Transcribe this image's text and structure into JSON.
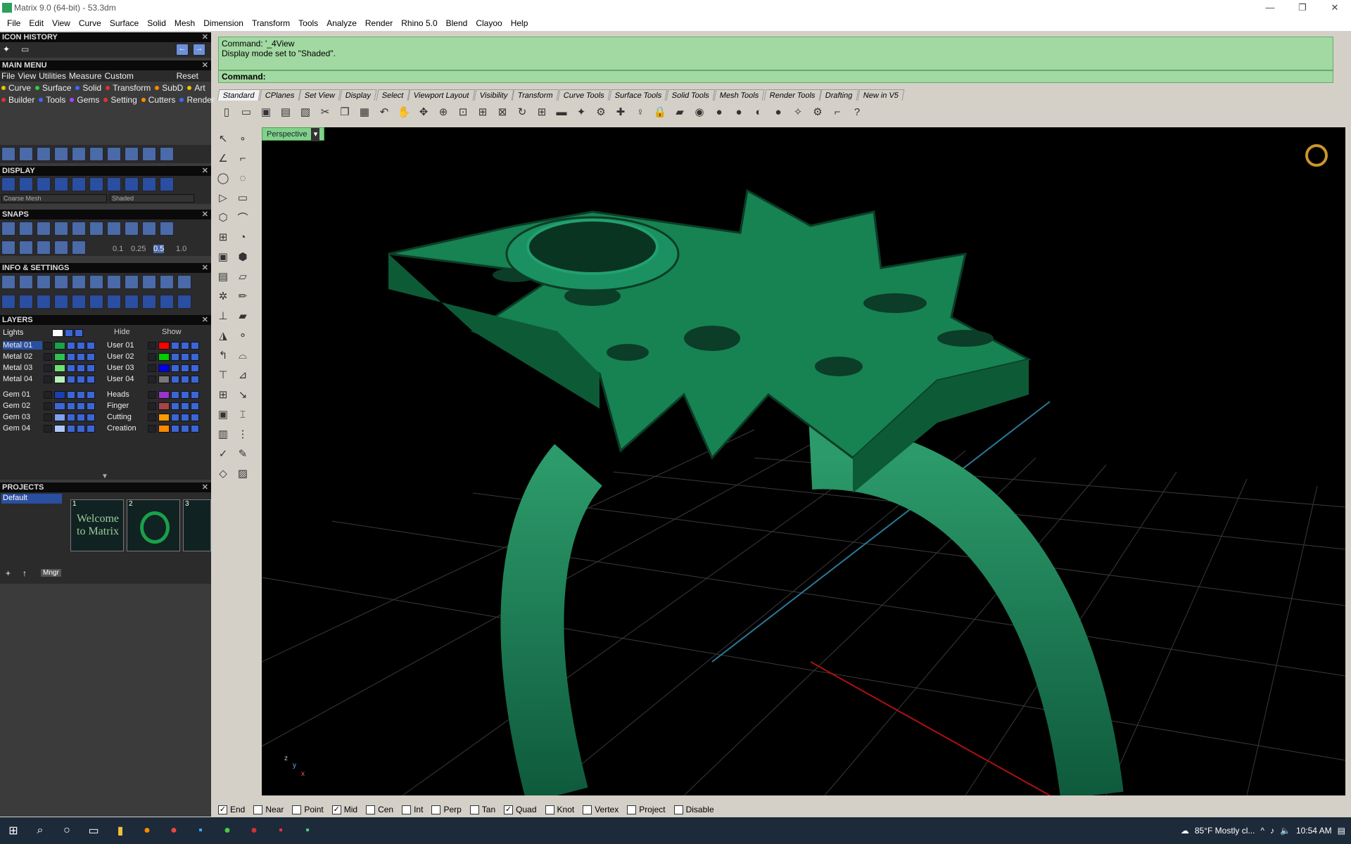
{
  "window": {
    "title": "Matrix 9.0 (64-bit) - 53.3dm",
    "controls": [
      "—",
      "❐",
      "✕"
    ]
  },
  "menubar": [
    "File",
    "Edit",
    "View",
    "Curve",
    "Surface",
    "Solid",
    "Mesh",
    "Dimension",
    "Transform",
    "Tools",
    "Analyze",
    "Render",
    "Rhino 5.0",
    "Blend",
    "Clayoo",
    "Help"
  ],
  "left": {
    "icon_history": "ICON HISTORY",
    "main_menu": "MAIN MENU",
    "mm_row1": [
      "File",
      "View",
      "Utilities",
      "Measure",
      "Custom"
    ],
    "mm_reset": "Reset",
    "mm_row2": [
      {
        "label": "Curve",
        "color": "#f0c000"
      },
      {
        "label": "Surface",
        "color": "#33cc44"
      },
      {
        "label": "Solid",
        "color": "#4466ff"
      },
      {
        "label": "Transform",
        "color": "#dd3333"
      },
      {
        "label": "SubD",
        "color": "#ff8800"
      },
      {
        "label": "Art",
        "color": "#f0c000"
      }
    ],
    "mm_row3": [
      {
        "label": "Builder",
        "color": "#dd3333"
      },
      {
        "label": "Tools",
        "color": "#4466ff"
      },
      {
        "label": "Gems",
        "color": "#aa44ff"
      },
      {
        "label": "Setting",
        "color": "#dd3333"
      },
      {
        "label": "Cutters",
        "color": "#ff8800"
      },
      {
        "label": "Render",
        "color": "#4466ff"
      }
    ],
    "display": "DISPLAY",
    "display_select1": "Coarse Mesh",
    "display_select2": "Shaded",
    "snaps": "SNAPS",
    "snap_values": [
      "0.1",
      "0.25",
      "0.5",
      "1.0"
    ],
    "info_settings": "INFO & SETTINGS",
    "layers": "LAYERS",
    "lights": "Lights",
    "hide": "Hide",
    "show": "Show",
    "layers_left": [
      {
        "name": "Metal 01",
        "color": "#1aa04a"
      },
      {
        "name": "Metal 02",
        "color": "#30c050"
      },
      {
        "name": "Metal 03",
        "color": "#70e070"
      },
      {
        "name": "Metal 04",
        "color": "#b8f0b8"
      },
      {
        "name": "Gem 01",
        "color": "#1a3fb0"
      },
      {
        "name": "Gem 02",
        "color": "#3f66d8"
      },
      {
        "name": "Gem 03",
        "color": "#7fa0ee"
      },
      {
        "name": "Gem 04",
        "color": "#b0c8f8"
      }
    ],
    "layers_right": [
      {
        "name": "User 01",
        "color": "#ff0000"
      },
      {
        "name": "User 02",
        "color": "#00cc00"
      },
      {
        "name": "User 03",
        "color": "#0000ee"
      },
      {
        "name": "User 04",
        "color": "#777777"
      },
      {
        "name": "Heads",
        "color": "#9933cc"
      },
      {
        "name": "Finger",
        "color": "#aa4444"
      },
      {
        "name": "Cutting",
        "color": "#ff9900"
      },
      {
        "name": "Creation",
        "color": "#ff8800"
      }
    ],
    "projects": "PROJECTS",
    "project_default": "Default",
    "thumb_labels": [
      "1",
      "2",
      "3"
    ],
    "thumb1_text": "Welcome to Matrix",
    "mngr": "Mngr"
  },
  "command": {
    "line1": "Command: '_4View",
    "line2": "Display mode set to \"Shaded\".",
    "prompt": "Command:"
  },
  "tabs": [
    "Standard",
    "CPlanes",
    "Set View",
    "Display",
    "Select",
    "Viewport Layout",
    "Visibility",
    "Transform",
    "Curve Tools",
    "Surface Tools",
    "Solid Tools",
    "Mesh Tools",
    "Render Tools",
    "Drafting",
    "New in V5"
  ],
  "viewport": {
    "label": "Perspective",
    "axis_z": "z",
    "axis_y": "y",
    "axis_x": "x"
  },
  "snapbar": [
    {
      "label": "End",
      "checked": true
    },
    {
      "label": "Near",
      "checked": false
    },
    {
      "label": "Point",
      "checked": false
    },
    {
      "label": "Mid",
      "checked": true
    },
    {
      "label": "Cen",
      "checked": false
    },
    {
      "label": "Int",
      "checked": false
    },
    {
      "label": "Perp",
      "checked": false
    },
    {
      "label": "Tan",
      "checked": false
    },
    {
      "label": "Quad",
      "checked": true
    },
    {
      "label": "Knot",
      "checked": false
    },
    {
      "label": "Vertex",
      "checked": false
    },
    {
      "label": "Project",
      "checked": false
    },
    {
      "label": "Disable",
      "checked": false
    }
  ],
  "taskbar": {
    "weather": "85°F  Mostly cl...",
    "time": "10:54 AM"
  }
}
